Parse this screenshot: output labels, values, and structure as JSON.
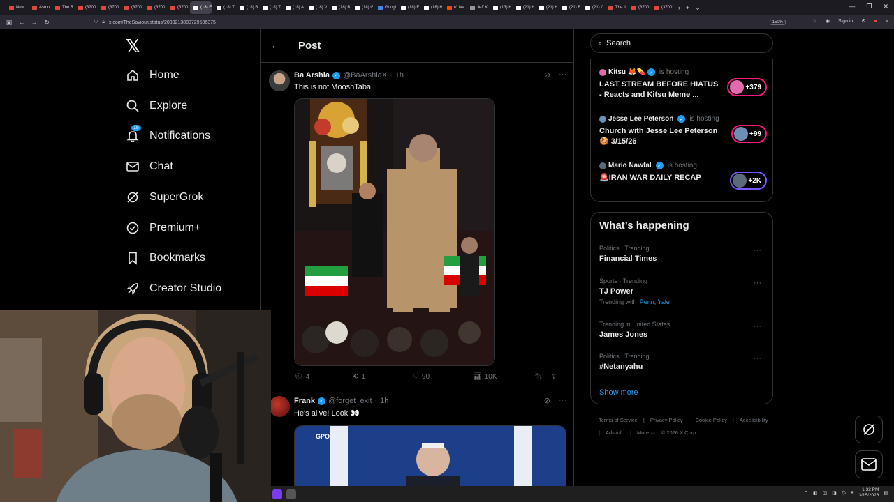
{
  "browser": {
    "tabs": [
      {
        "label": "New",
        "color": "#e3473a"
      },
      {
        "label": "Asmo",
        "color": "#e3473a"
      },
      {
        "label": "The R",
        "color": "#e3473a"
      },
      {
        "label": "(3700",
        "color": "#e3473a"
      },
      {
        "label": "(3700",
        "color": "#e3473a"
      },
      {
        "label": "(3700",
        "color": "#e3473a"
      },
      {
        "label": "(3700",
        "color": "#e3473a"
      },
      {
        "label": "(3700",
        "color": "#e3473a"
      },
      {
        "label": "(18) F",
        "color": "#ffffff"
      },
      {
        "label": "(18) T",
        "color": "#ffffff"
      },
      {
        "label": "(18) B",
        "color": "#ffffff"
      },
      {
        "label": "(18) T",
        "color": "#ffffff"
      },
      {
        "label": "(18) A",
        "color": "#ffffff"
      },
      {
        "label": "(18) V",
        "color": "#ffffff"
      },
      {
        "label": "(18) B",
        "color": "#ffffff"
      },
      {
        "label": "(18) G",
        "color": "#ffffff"
      },
      {
        "label": "Googl",
        "color": "#4285f4"
      },
      {
        "label": "(18) F",
        "color": "#ffffff"
      },
      {
        "label": "(18) H",
        "color": "#ffffff"
      },
      {
        "label": "r/Live",
        "color": "#ff4500"
      },
      {
        "label": "Jeff K",
        "color": "#999999"
      },
      {
        "label": "(13) H",
        "color": "#ffffff"
      },
      {
        "label": "(21) H",
        "color": "#ffffff"
      },
      {
        "label": "(21) H",
        "color": "#ffffff"
      },
      {
        "label": "(21) B",
        "color": "#ffffff"
      },
      {
        "label": "(21) C",
        "color": "#ffffff"
      },
      {
        "label": "The li",
        "color": "#e3473a"
      },
      {
        "label": "(3700",
        "color": "#e3473a"
      },
      {
        "label": "(3700",
        "color": "#e3473a"
      }
    ],
    "active_tab_label": "(18)",
    "url": "x.com/TheSaviour/status/2033213883729506375",
    "zoom": "150%",
    "sign_in": "Sign in"
  },
  "nav": {
    "items": [
      {
        "label": "Home",
        "icon": "home-icon"
      },
      {
        "label": "Explore",
        "icon": "search-icon"
      },
      {
        "label": "Notifications",
        "icon": "bell-icon"
      },
      {
        "label": "Chat",
        "icon": "mail-icon"
      },
      {
        "label": "SuperGrok",
        "icon": "grok-icon"
      },
      {
        "label": "Premium+",
        "icon": "verified-icon"
      },
      {
        "label": "Bookmarks",
        "icon": "bookmark-icon"
      },
      {
        "label": "Creator Studio",
        "icon": "rocket-icon"
      }
    ],
    "notifications_badge": "18"
  },
  "post": {
    "header_title": "Post",
    "tweets": [
      {
        "name": "Ba Arshia",
        "handle": "@BaArshiaX",
        "time": "1h",
        "text": "This is not MooshTaba",
        "replies": "4",
        "reposts": "1",
        "likes": "90",
        "views": "10K"
      },
      {
        "name": "Frank",
        "handle": "@forget_exit",
        "time": "1h",
        "text": "He's alive! Look 👀",
        "media_label": "GPO"
      }
    ]
  },
  "sidebar": {
    "search_placeholder": "Search",
    "spaces": [
      {
        "host": "Kitsu",
        "emoji": "🦊💊",
        "hosting": "is hosting",
        "title": "LAST STREAM BEFORE HIATUS - Reacts and Kitsu Meme ...",
        "count": "+379",
        "pill_color": "#f91880",
        "avatar_color": "#e26bb0"
      },
      {
        "host": "Jesse Lee Peterson",
        "emoji": "",
        "hosting": "is hosting",
        "title": "Church with Jesse Lee Peterson 🍪 3/15/26",
        "count": "+99",
        "pill_color": "#f91880",
        "avatar_color": "#6b8fb5"
      },
      {
        "host": "Mario Nawfal",
        "emoji": "",
        "hosting": "is hosting",
        "title": "🚨IRAN WAR DAILY RECAP",
        "count": "+2K",
        "pill_color": "#7856ff",
        "avatar_color": "#5a6a7a"
      }
    ],
    "happening_title": "What’s happening",
    "trends": [
      {
        "category": "Politics · Trending",
        "title": "Financial Times",
        "with": "",
        "links": []
      },
      {
        "category": "Sports · Trending",
        "title": "TJ Power",
        "with": "Trending with",
        "links": [
          "Penn, Yale"
        ]
      },
      {
        "category": "Trending in United States",
        "title": "James Jones",
        "with": "",
        "links": []
      },
      {
        "category": "Politics · Trending",
        "title": "#Netanyahu",
        "with": "",
        "links": []
      }
    ],
    "show_more": "Show more",
    "footer": [
      "Terms of Service",
      "|",
      "Privacy Policy",
      "|",
      "Cookie Policy",
      "|",
      "Accessibility",
      "|",
      "Ads info",
      "|",
      "More ···",
      "© 2026 X Corp."
    ]
  },
  "taskbar": {
    "time": "1:32 PM",
    "date": "3/15/2026"
  },
  "colors": {
    "accent": "#1d9bf0",
    "background": "#000000",
    "border": "#2f3336",
    "muted": "#71767b"
  }
}
